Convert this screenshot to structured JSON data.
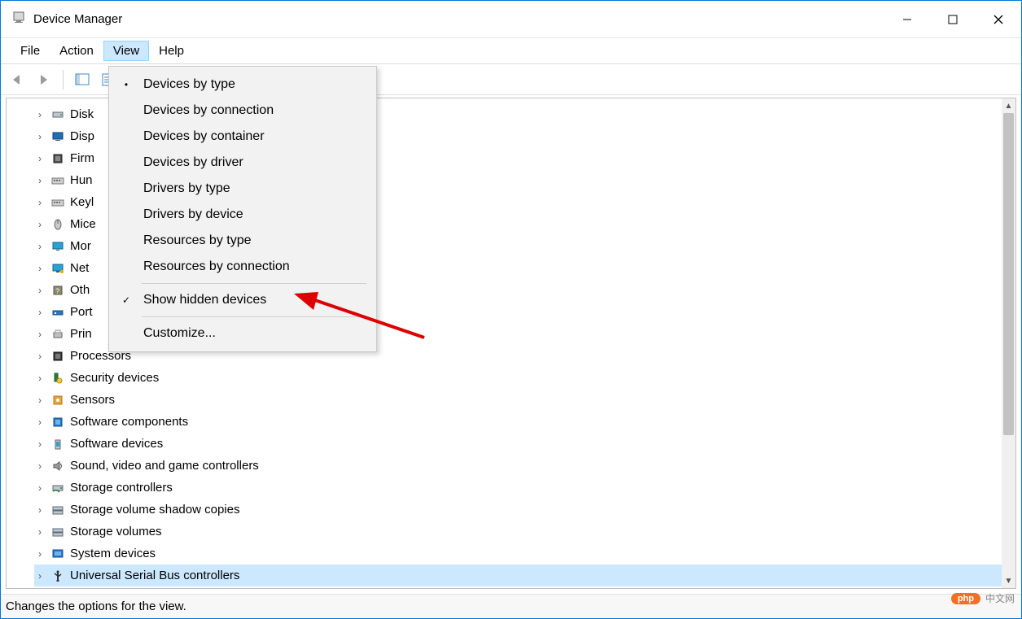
{
  "window": {
    "title": "Device Manager"
  },
  "menubar": {
    "items": [
      {
        "label": "File"
      },
      {
        "label": "Action"
      },
      {
        "label": "View",
        "active": true
      },
      {
        "label": "Help"
      }
    ]
  },
  "view_menu": {
    "items": [
      {
        "label": "Devices by type",
        "mark": "dot"
      },
      {
        "label": "Devices by connection"
      },
      {
        "label": "Devices by container"
      },
      {
        "label": "Devices by driver"
      },
      {
        "label": "Drivers by type"
      },
      {
        "label": "Drivers by device"
      },
      {
        "label": "Resources by type"
      },
      {
        "label": "Resources by connection"
      },
      {
        "sep": true
      },
      {
        "label": "Show hidden devices",
        "mark": "check"
      },
      {
        "sep": true
      },
      {
        "label": "Customize..."
      }
    ]
  },
  "tree": {
    "items": [
      {
        "label": "Disk",
        "icon": "disk",
        "truncated": true
      },
      {
        "label": "Disp",
        "icon": "display",
        "truncated": true
      },
      {
        "label": "Firm",
        "icon": "firmware",
        "truncated": true
      },
      {
        "label": "Hun",
        "icon": "keyboard",
        "truncated": true
      },
      {
        "label": "Keyl",
        "icon": "keyboard",
        "truncated": true
      },
      {
        "label": "Mice",
        "icon": "mouse",
        "truncated": true
      },
      {
        "label": "Mor",
        "icon": "monitor",
        "truncated": true
      },
      {
        "label": "Net",
        "icon": "network",
        "truncated": true
      },
      {
        "label": "Oth",
        "icon": "other",
        "truncated": true
      },
      {
        "label": "Port",
        "icon": "port",
        "truncated": true
      },
      {
        "label": "Prin",
        "icon": "printer",
        "truncated": true
      },
      {
        "label": "Processors",
        "icon": "cpu",
        "truncated": true,
        "partial": true
      },
      {
        "label": "Security devices",
        "icon": "security"
      },
      {
        "label": "Sensors",
        "icon": "sensor"
      },
      {
        "label": "Software components",
        "icon": "component"
      },
      {
        "label": "Software devices",
        "icon": "software"
      },
      {
        "label": "Sound, video and game controllers",
        "icon": "sound"
      },
      {
        "label": "Storage controllers",
        "icon": "storage"
      },
      {
        "label": "Storage volume shadow copies",
        "icon": "volume"
      },
      {
        "label": "Storage volumes",
        "icon": "volume"
      },
      {
        "label": "System devices",
        "icon": "system"
      },
      {
        "label": "Universal Serial Bus controllers",
        "icon": "usb",
        "selected": true
      }
    ]
  },
  "statusbar": {
    "text": "Changes the options for the view."
  },
  "watermark": {
    "badge": "php",
    "text": "中文网"
  }
}
